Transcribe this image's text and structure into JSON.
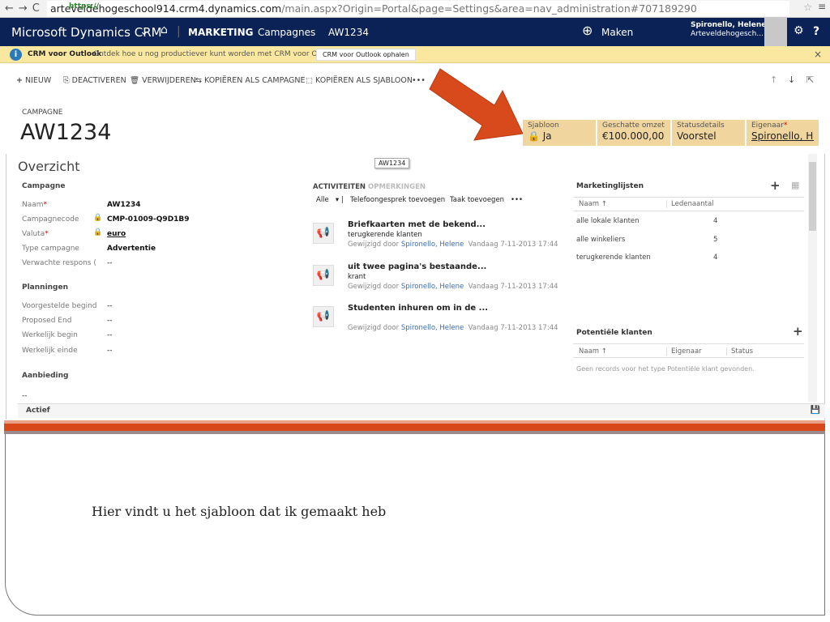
{
  "browser": {
    "url_scheme": "https://",
    "url_domain": "arteveldehogeschool914.crm4.dynamics.com",
    "url_path": "/main.aspx?Origin=Portal&page=Settings&area=nav_administration#707189290"
  },
  "nav": {
    "brand": "Microsoft Dynamics CRM",
    "area": "MARKETING",
    "entity": "Campagnes",
    "record": "AW1234",
    "create": "Maken",
    "user_name": "Spironello, Helene",
    "user_org": "Arteveldehogesch..."
  },
  "infobar": {
    "title": "CRM voor Outlook",
    "message": "Ontdek hoe u nog productiever kunt worden met CRM voor Outlook.",
    "button": "CRM voor Outlook ophalen"
  },
  "toolbar": {
    "new": "NIEUW",
    "deactivate": "DEACTIVEREN",
    "delete": "VERWIJDEREN",
    "copy_campaign": "KOPIËREN ALS CAMPAGNE",
    "copy_template": "KOPIËREN ALS SJABLOON",
    "more": "•••"
  },
  "record": {
    "entity_label": "CAMPAGNE",
    "title": "AW1234",
    "tooltip": "AW1234"
  },
  "header_fields": [
    {
      "label": "Sjabloon",
      "value": "Ja"
    },
    {
      "label": "Geschatte omzet",
      "value": "€100.000,00"
    },
    {
      "label": "Statusdetails",
      "value": "Voorstel"
    },
    {
      "label": "Eigenaar",
      "value": "Spironello, He"
    }
  ],
  "overview": {
    "title": "Overzicht",
    "section_campaign": "Campagne",
    "fields": [
      {
        "label": "Naam",
        "value": "AW1234"
      },
      {
        "label": "Campagnecode",
        "value": "CMP-01009-Q9D1B9"
      },
      {
        "label": "Valuta",
        "value": "euro"
      },
      {
        "label": "Type campagne",
        "value": "Advertentie"
      },
      {
        "label": "Verwachte respons (",
        "value": "--"
      }
    ],
    "section_planning": "Planningen",
    "planning": [
      {
        "label": "Voorgestelde begind",
        "value": "--"
      },
      {
        "label": "Proposed End",
        "value": "--"
      },
      {
        "label": "Werkelijk begin",
        "value": "--"
      },
      {
        "label": "Werkelijk einde",
        "value": "--"
      }
    ],
    "section_offer": "Aanbieding",
    "offer_value": "--"
  },
  "activities": {
    "tab_activities": "ACTIVITEITEN",
    "tab_notes": "OPMERKINGEN",
    "filter": "Alle",
    "add_call": "Telefoongesprek toevoegen",
    "add_task": "Taak toevoegen",
    "more": "•••",
    "items": [
      {
        "title": "Briefkaarten met de bekend...",
        "sub": "terugkerende klanten",
        "modified_by_label": "Gewijzigd door",
        "user": "Spironello, Helene",
        "date": "Vandaag 7-11-2013 17:44"
      },
      {
        "title": "uit twee pagina's bestaande...",
        "sub": "krant",
        "modified_by_label": "Gewijzigd door",
        "user": "Spironello, Helene",
        "date": "Vandaag 7-11-2013 17:44"
      },
      {
        "title": "Studenten inhuren om in de ...",
        "sub": "",
        "modified_by_label": "Gewijzigd door",
        "user": "Spironello, Helene",
        "date": "Vandaag 7-11-2013 17:44"
      }
    ]
  },
  "marketing_lists": {
    "title": "Marketinglijsten",
    "col_name": "Naam ↑",
    "col_count": "Ledenaantal",
    "rows": [
      {
        "name": "alle lokale klanten",
        "count": "4"
      },
      {
        "name": "alle winkeliers",
        "count": "5"
      },
      {
        "name": "terugkerende klanten",
        "count": "4"
      }
    ]
  },
  "leads": {
    "title": "Potentiële klanten",
    "col_name": "Naam ↑",
    "col_owner": "Eigenaar",
    "col_status": "Status",
    "empty": "Geen records voor het type Potentiële klant gevonden."
  },
  "status": {
    "label": "Actief"
  },
  "caption": "Hier vindt u het sjabloon dat ik gemaakt heb",
  "colors": {
    "nav": "#0b2257",
    "header_field": "#f1d59e",
    "arrow": "#d84a1b",
    "accent_bar": "#d9481a"
  }
}
